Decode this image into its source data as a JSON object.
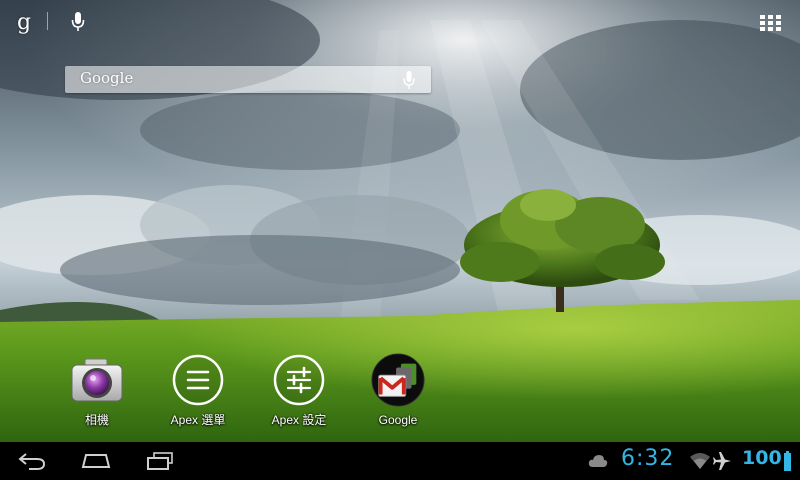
{
  "top_bar": {
    "google_glyph": "g",
    "icons": [
      "google-search-icon",
      "voice-search-icon",
      "all-apps-grid-icon"
    ]
  },
  "search_widget": {
    "placeholder": "Google",
    "icons": [
      "microphone-icon"
    ]
  },
  "shortcuts": [
    {
      "label": "相機",
      "icon": "camera-icon"
    },
    {
      "label": "Apex 選單",
      "icon": "apex-menu-icon"
    },
    {
      "label": "Apex 設定",
      "icon": "apex-settings-icon"
    },
    {
      "label": "Google",
      "icon": "google-folder-icon"
    }
  ],
  "navbar": {
    "buttons": [
      "back-icon",
      "home-icon",
      "recent-apps-icon"
    ]
  },
  "status": {
    "clock": "6:32",
    "battery": "100",
    "icons": [
      "cloud-notification-icon",
      "wifi-icon",
      "airplane-icon",
      "battery-icon"
    ],
    "accent_color": "#33b5e5"
  }
}
